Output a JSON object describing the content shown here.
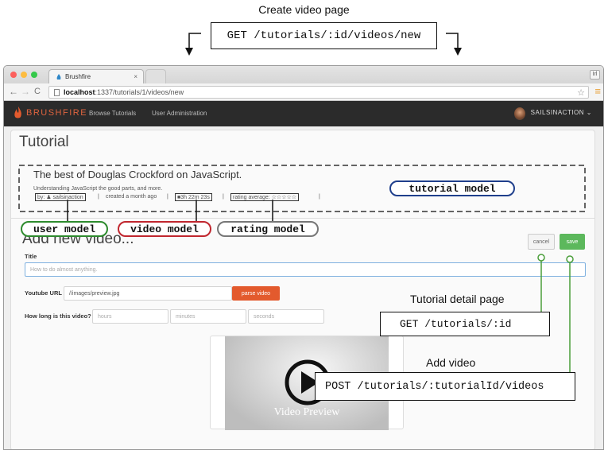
{
  "annotations": {
    "page_caption": "Create video page",
    "page_route": "GET /tutorials/:id/videos/new",
    "tutorial_model": "tutorial model",
    "user_model": "user model",
    "video_model": "video model",
    "rating_model": "rating model",
    "detail_caption": "Tutorial detail page",
    "detail_route": "GET /tutorials/:id",
    "add_caption": "Add video",
    "add_route": "POST /tutorials/:tutorialId/videos",
    "colors": {
      "tutorial": "#1f3f8c",
      "user": "#2e8b2e",
      "video": "#c0262e",
      "rating": "#777777",
      "route_line": "#4a9e3a"
    }
  },
  "browser": {
    "tab_title": "Brushfire",
    "tab_close": "×",
    "profile_label": "Irl",
    "url_host": "localhost",
    "url_path": ":1337/tutorials/1/videos/new",
    "back_icon": "back-arrow-icon",
    "forward_icon": "forward-arrow-icon",
    "reload_icon": "reload-icon"
  },
  "app": {
    "brand": "BRUSHFIRE",
    "nav": [
      "Browse Tutorials",
      "User Administration"
    ],
    "account": "SAILSINACTION",
    "account_caret": "⌄",
    "accent": "#e35a2d"
  },
  "tutorial": {
    "heading": "Tutorial",
    "title": "The best of Douglas Crockford on JavaScript.",
    "description": "Understanding JavaScript the good parts, and more.",
    "author": "by: ♟ sailsinaction",
    "created": "created a month ago",
    "duration": "3h 22m 23s",
    "rating_label": "rating average:",
    "rating_stars": "☆☆☆☆☆",
    "separator": "|"
  },
  "form": {
    "heading": "Add new video...",
    "title_label": "Title",
    "title_placeholder": "How to do almost anything.",
    "youtube_label": "Youtube URL",
    "youtube_value": "//images/preview.jpg",
    "parse_button": "parse video",
    "length_label": "How long is this video?",
    "hours_placeholder": "hours",
    "minutes_placeholder": "minutes",
    "seconds_placeholder": "seconds",
    "cancel_button": "cancel",
    "save_button": "save",
    "preview_text": "Video Preview"
  }
}
